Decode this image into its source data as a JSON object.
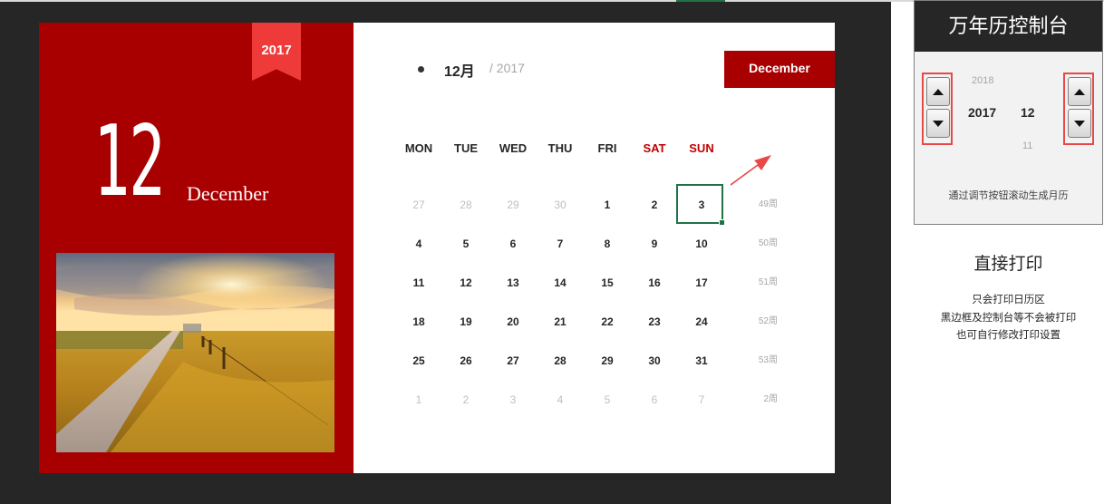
{
  "calendar": {
    "ribbon_year": "2017",
    "big_day": "12",
    "month_en": "December",
    "month_cn": "12月",
    "year_label": "/ 2017",
    "month_tag": "December",
    "weekdays": [
      "MON",
      "TUE",
      "WED",
      "THU",
      "FRI",
      "SAT",
      "SUN"
    ],
    "weeks": [
      {
        "days": [
          "27",
          "28",
          "29",
          "30",
          "1",
          "2",
          "3"
        ],
        "muted": [
          true,
          true,
          true,
          true,
          false,
          false,
          false
        ],
        "week": "49周"
      },
      {
        "days": [
          "4",
          "5",
          "6",
          "7",
          "8",
          "9",
          "10"
        ],
        "muted": [
          false,
          false,
          false,
          false,
          false,
          false,
          false
        ],
        "week": "50周"
      },
      {
        "days": [
          "11",
          "12",
          "13",
          "14",
          "15",
          "16",
          "17"
        ],
        "muted": [
          false,
          false,
          false,
          false,
          false,
          false,
          false
        ],
        "week": "51周"
      },
      {
        "days": [
          "18",
          "19",
          "20",
          "21",
          "22",
          "23",
          "24"
        ],
        "muted": [
          false,
          false,
          false,
          false,
          false,
          false,
          false
        ],
        "week": "52周"
      },
      {
        "days": [
          "25",
          "26",
          "27",
          "28",
          "29",
          "30",
          "31"
        ],
        "muted": [
          false,
          false,
          false,
          false,
          false,
          false,
          false
        ],
        "week": "53周"
      },
      {
        "days": [
          "1",
          "2",
          "3",
          "4",
          "5",
          "6",
          "7"
        ],
        "muted": [
          true,
          true,
          true,
          true,
          true,
          true,
          true
        ],
        "week": "2周"
      }
    ],
    "selected_day": "3"
  },
  "control": {
    "title": "万年历控制台",
    "year_prev": "2018",
    "year": "2017",
    "month": "12",
    "month_next": "11",
    "hint": "通过调节按钮滚动生成月历"
  },
  "print": {
    "title": "直接打印",
    "notes": [
      "只会打印日历区",
      "黑边框及控制台等不会被打印",
      "也可自行修改打印设置"
    ]
  },
  "colors": {
    "accent_red": "#a80000",
    "ribbon_red": "#ef3a3a",
    "weekend_red": "#c00000",
    "highlight_green": "#217346",
    "spinner_border": "#e84848"
  },
  "icons": [
    "up-arrow-icon",
    "down-arrow-icon",
    "pointer-arrow-icon"
  ]
}
